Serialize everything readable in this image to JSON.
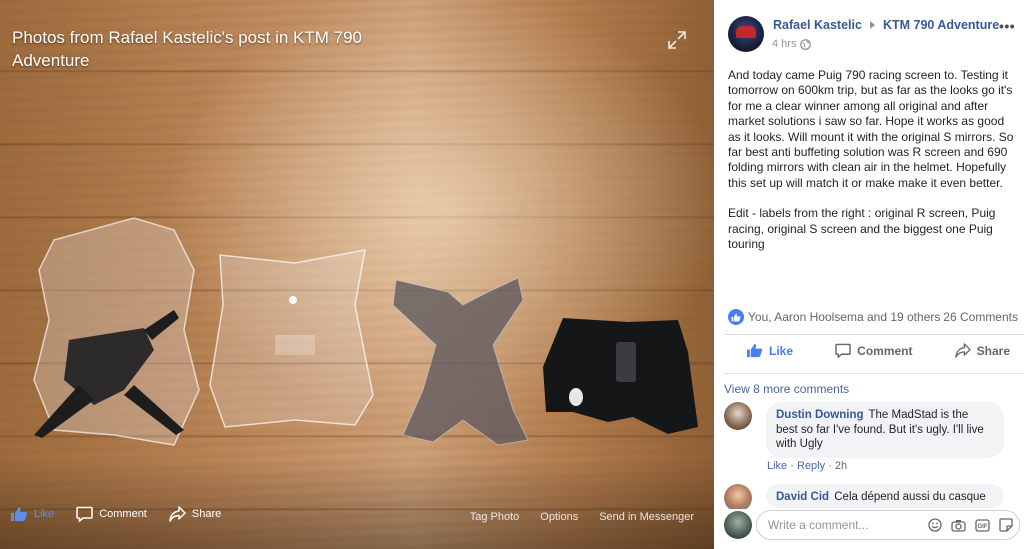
{
  "viewer": {
    "title": "Photos from Rafael Kastelic's post in KTM 790 Adventure",
    "actions": {
      "like": "Like",
      "comment": "Comment",
      "share": "Share"
    },
    "links": {
      "tag_photo": "Tag Photo",
      "options": "Options",
      "send_in_messenger": "Send in Messenger"
    },
    "expand_icon": "expand-icon"
  },
  "post": {
    "author": "Rafael Kastelic",
    "group": "KTM 790 Adventure",
    "time": "4 hrs",
    "audience_icon": "globe-icon",
    "more_icon": "•••",
    "body_paragraph_1": "And today came Puig 790 racing screen to. Testing it tomorrow on 600km trip, but as far as the looks go it's for me a clear winner among all original and after market solutions i saw so far. Hope it works as good as it looks. Will mount it with the original S mirrors. So far best anti buffeting solution was R screen and 690 folding mirrors with clean air in the helmet. Hopefully this set up will match it or make make it even better.",
    "body_paragraph_2": "Edit - labels from the right : original R screen, Puig racing, original S screen and the biggest one Puig touring",
    "reactions_text": "You, Aaron Hoolsema and 19 others",
    "comments_count": "26 Comments",
    "actions": {
      "like": "Like",
      "comment": "Comment",
      "share": "Share"
    }
  },
  "comments": {
    "view_more": "View 8 more comments",
    "items": [
      {
        "name": "Dustin Downing",
        "text": "The MadStad is the best so far I've found. But it's ugly. I'll live with Ugly",
        "like": "Like",
        "reply": "Reply",
        "time": "2h"
      },
      {
        "name": "David Cid",
        "text": "Cela dépend aussi du casque"
      }
    ],
    "composer_placeholder": "Write a comment..."
  },
  "colors": {
    "link_blue": "#385898",
    "like_blue": "#4a7ef0",
    "muted": "#606770"
  }
}
